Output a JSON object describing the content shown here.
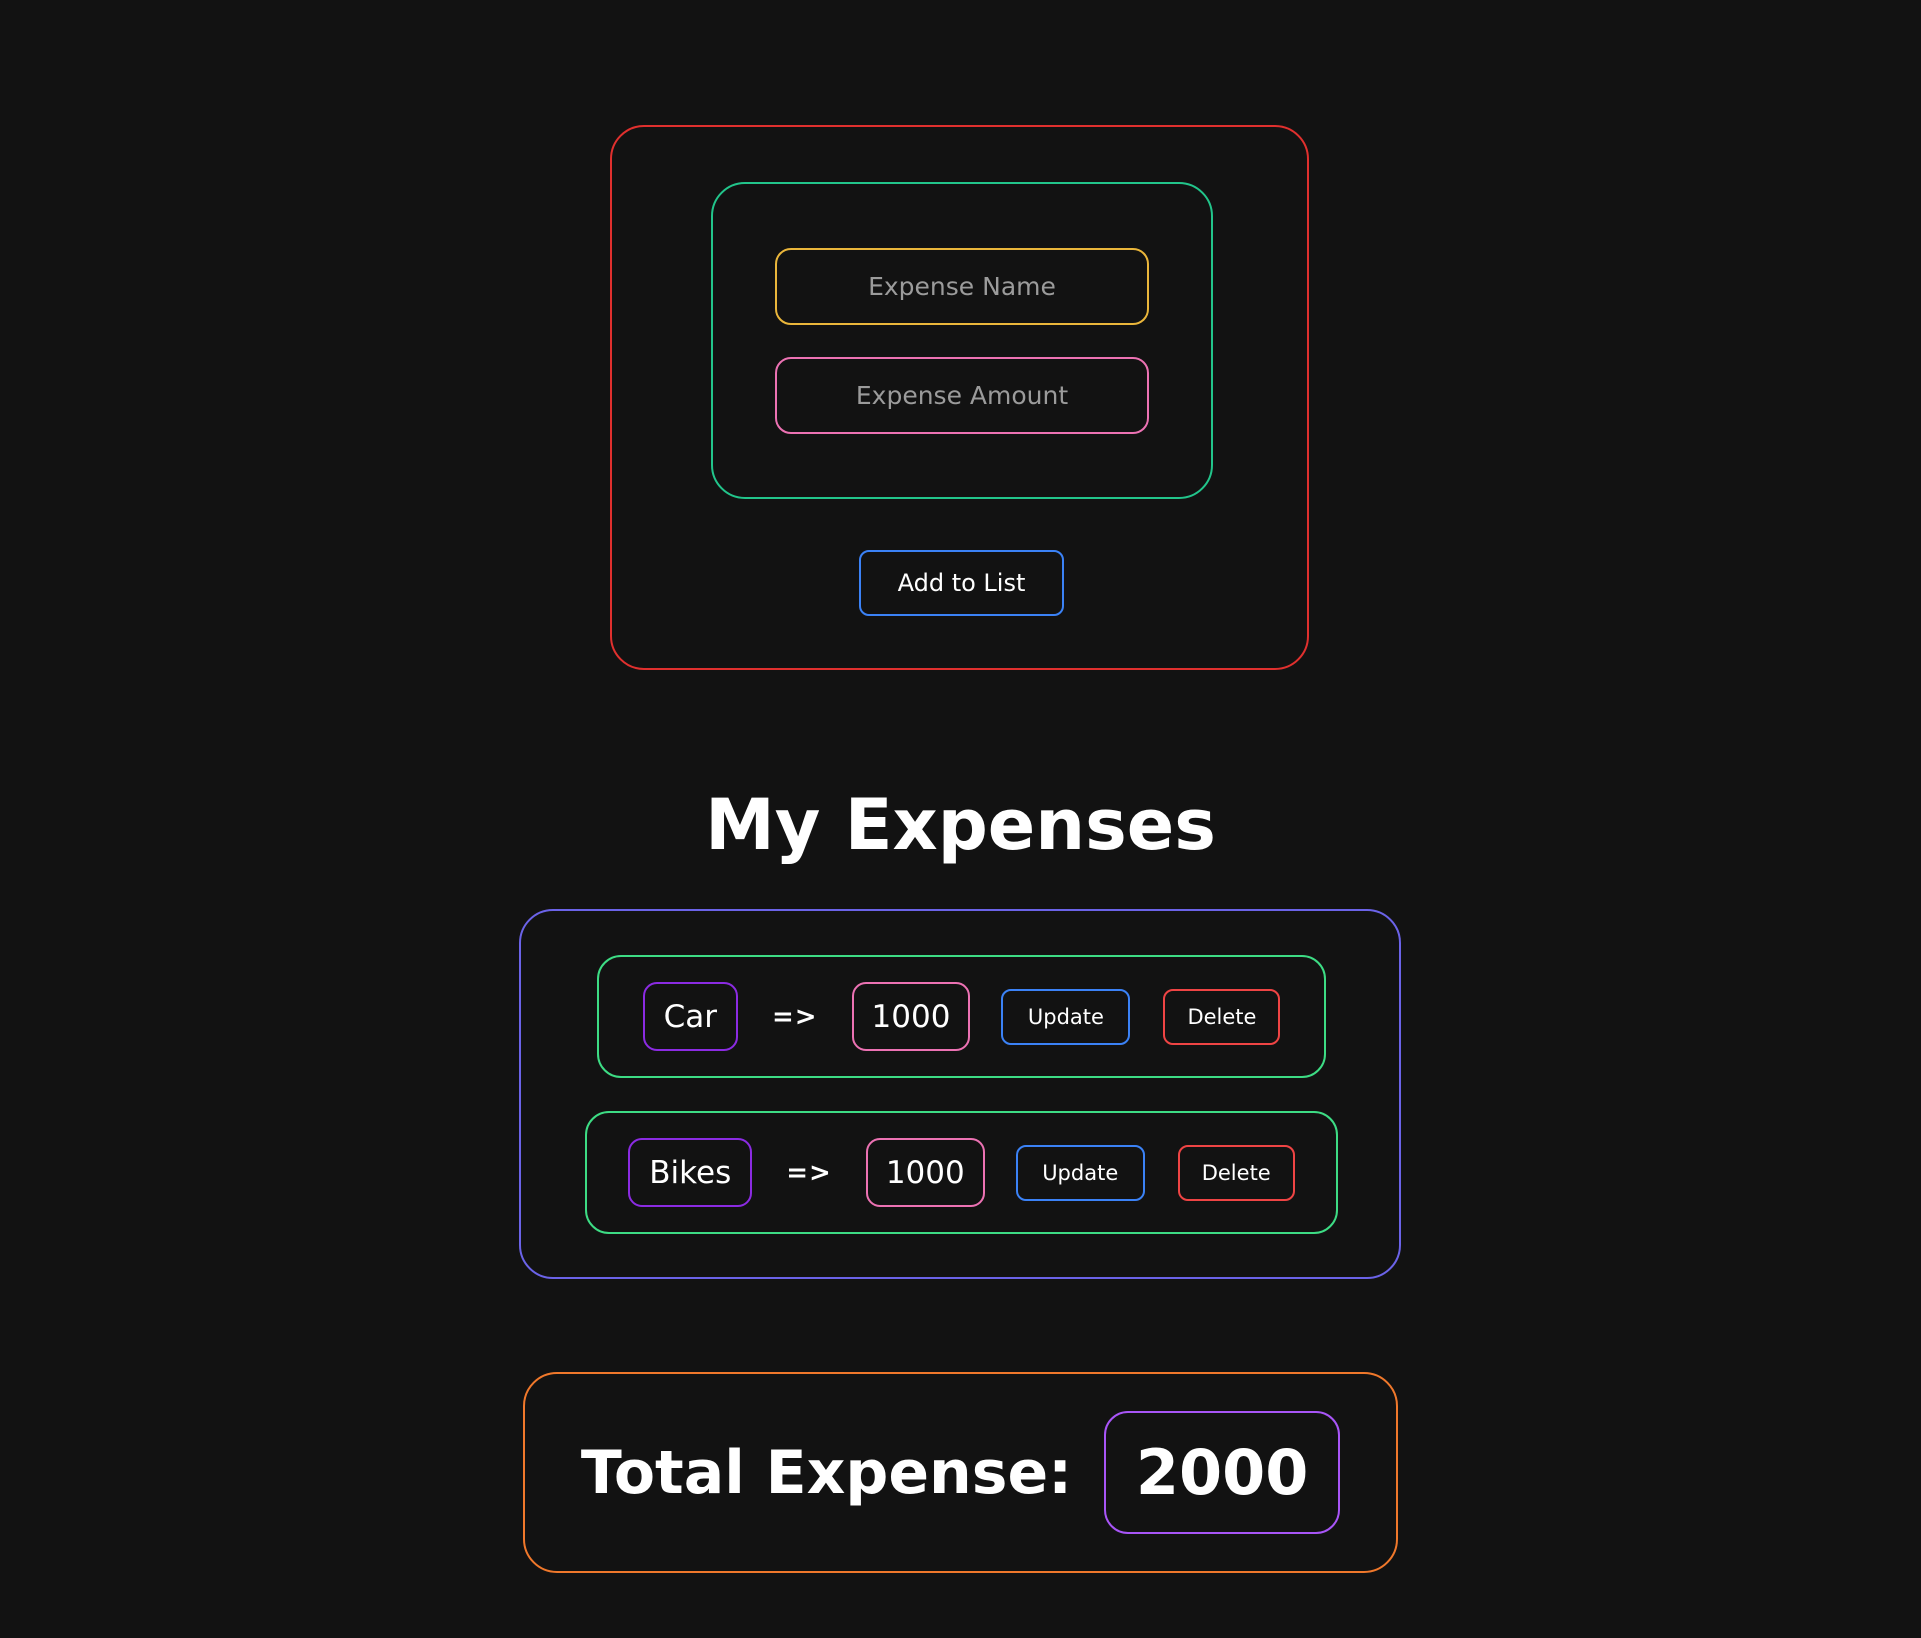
{
  "form": {
    "name_placeholder": "Expense Name",
    "amount_placeholder": "Expense Amount",
    "add_label": "Add to List"
  },
  "heading": "My Expenses",
  "expenses": [
    {
      "name": "Car",
      "arrow": "=>",
      "amount": "1000",
      "update_label": "Update",
      "delete_label": "Delete"
    },
    {
      "name": "Bikes",
      "arrow": "=>",
      "amount": "1000",
      "update_label": "Update",
      "delete_label": "Delete"
    }
  ],
  "total": {
    "label": "Total Expense:",
    "value": "2000"
  },
  "colors": {
    "background": "#121212",
    "form_border": "#e0302e",
    "inputs_border": "#22c58b",
    "name_input_border": "#eab63b",
    "amount_input_border": "#ec72b3",
    "button_border": "#3b82f6",
    "list_border": "#6b63e8",
    "row_border": "#3ddc84",
    "name_chip_border": "#8b2be2",
    "delete_border": "#ef4444",
    "total_border": "#f0782b",
    "total_value_border": "#a855f7"
  }
}
